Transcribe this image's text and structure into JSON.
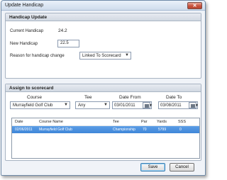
{
  "window": {
    "title": "Update Handicap",
    "close_glyph": "✕"
  },
  "handicap_update": {
    "header": "Handicap Update",
    "current_label": "Current Handicap",
    "current_value": "24.2",
    "new_label": "New Handicap",
    "new_value": "22.5",
    "reason_label": "Reason for handicap change",
    "reason_value": "Linked To Scorecard"
  },
  "assign": {
    "header": "Assign to scorecard",
    "course_label": "Course",
    "course_value": "Murrayfield Golf Club",
    "tee_label": "Tee",
    "tee_value": "Any",
    "date_from_label": "Date From",
    "date_from_value": "03/01/2011",
    "date_to_label": "Date To",
    "date_to_value": "03/08/2011"
  },
  "grid": {
    "columns": [
      "Date",
      "Course Name",
      "Tee",
      "Par",
      "Yards",
      "SSS"
    ],
    "rows": [
      {
        "date": "02/06/2011",
        "course": "Murrayfield Golf Club",
        "tee": "Championship",
        "par": "70",
        "yards": "5799",
        "sss": "0"
      }
    ]
  },
  "buttons": {
    "save": "Save",
    "cancel": "Cancel"
  },
  "icons": {
    "dropdown": "chevron-down-icon",
    "calendar": "calendar-icon",
    "close": "close-icon"
  }
}
